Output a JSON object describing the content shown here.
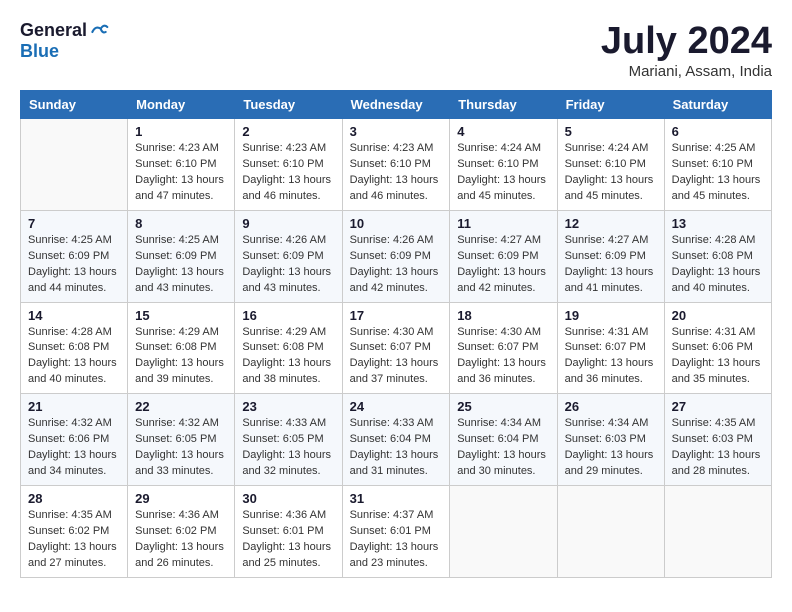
{
  "header": {
    "logo_general": "General",
    "logo_blue": "Blue",
    "month_year": "July 2024",
    "location": "Mariani, Assam, India"
  },
  "calendar": {
    "columns": [
      "Sunday",
      "Monday",
      "Tuesday",
      "Wednesday",
      "Thursday",
      "Friday",
      "Saturday"
    ],
    "weeks": [
      [
        {
          "day": "",
          "info": ""
        },
        {
          "day": "1",
          "info": "Sunrise: 4:23 AM\nSunset: 6:10 PM\nDaylight: 13 hours\nand 47 minutes."
        },
        {
          "day": "2",
          "info": "Sunrise: 4:23 AM\nSunset: 6:10 PM\nDaylight: 13 hours\nand 46 minutes."
        },
        {
          "day": "3",
          "info": "Sunrise: 4:23 AM\nSunset: 6:10 PM\nDaylight: 13 hours\nand 46 minutes."
        },
        {
          "day": "4",
          "info": "Sunrise: 4:24 AM\nSunset: 6:10 PM\nDaylight: 13 hours\nand 45 minutes."
        },
        {
          "day": "5",
          "info": "Sunrise: 4:24 AM\nSunset: 6:10 PM\nDaylight: 13 hours\nand 45 minutes."
        },
        {
          "day": "6",
          "info": "Sunrise: 4:25 AM\nSunset: 6:10 PM\nDaylight: 13 hours\nand 45 minutes."
        }
      ],
      [
        {
          "day": "7",
          "info": "Sunrise: 4:25 AM\nSunset: 6:09 PM\nDaylight: 13 hours\nand 44 minutes."
        },
        {
          "day": "8",
          "info": "Sunrise: 4:25 AM\nSunset: 6:09 PM\nDaylight: 13 hours\nand 43 minutes."
        },
        {
          "day": "9",
          "info": "Sunrise: 4:26 AM\nSunset: 6:09 PM\nDaylight: 13 hours\nand 43 minutes."
        },
        {
          "day": "10",
          "info": "Sunrise: 4:26 AM\nSunset: 6:09 PM\nDaylight: 13 hours\nand 42 minutes."
        },
        {
          "day": "11",
          "info": "Sunrise: 4:27 AM\nSunset: 6:09 PM\nDaylight: 13 hours\nand 42 minutes."
        },
        {
          "day": "12",
          "info": "Sunrise: 4:27 AM\nSunset: 6:09 PM\nDaylight: 13 hours\nand 41 minutes."
        },
        {
          "day": "13",
          "info": "Sunrise: 4:28 AM\nSunset: 6:08 PM\nDaylight: 13 hours\nand 40 minutes."
        }
      ],
      [
        {
          "day": "14",
          "info": "Sunrise: 4:28 AM\nSunset: 6:08 PM\nDaylight: 13 hours\nand 40 minutes."
        },
        {
          "day": "15",
          "info": "Sunrise: 4:29 AM\nSunset: 6:08 PM\nDaylight: 13 hours\nand 39 minutes."
        },
        {
          "day": "16",
          "info": "Sunrise: 4:29 AM\nSunset: 6:08 PM\nDaylight: 13 hours\nand 38 minutes."
        },
        {
          "day": "17",
          "info": "Sunrise: 4:30 AM\nSunset: 6:07 PM\nDaylight: 13 hours\nand 37 minutes."
        },
        {
          "day": "18",
          "info": "Sunrise: 4:30 AM\nSunset: 6:07 PM\nDaylight: 13 hours\nand 36 minutes."
        },
        {
          "day": "19",
          "info": "Sunrise: 4:31 AM\nSunset: 6:07 PM\nDaylight: 13 hours\nand 36 minutes."
        },
        {
          "day": "20",
          "info": "Sunrise: 4:31 AM\nSunset: 6:06 PM\nDaylight: 13 hours\nand 35 minutes."
        }
      ],
      [
        {
          "day": "21",
          "info": "Sunrise: 4:32 AM\nSunset: 6:06 PM\nDaylight: 13 hours\nand 34 minutes."
        },
        {
          "day": "22",
          "info": "Sunrise: 4:32 AM\nSunset: 6:05 PM\nDaylight: 13 hours\nand 33 minutes."
        },
        {
          "day": "23",
          "info": "Sunrise: 4:33 AM\nSunset: 6:05 PM\nDaylight: 13 hours\nand 32 minutes."
        },
        {
          "day": "24",
          "info": "Sunrise: 4:33 AM\nSunset: 6:04 PM\nDaylight: 13 hours\nand 31 minutes."
        },
        {
          "day": "25",
          "info": "Sunrise: 4:34 AM\nSunset: 6:04 PM\nDaylight: 13 hours\nand 30 minutes."
        },
        {
          "day": "26",
          "info": "Sunrise: 4:34 AM\nSunset: 6:03 PM\nDaylight: 13 hours\nand 29 minutes."
        },
        {
          "day": "27",
          "info": "Sunrise: 4:35 AM\nSunset: 6:03 PM\nDaylight: 13 hours\nand 28 minutes."
        }
      ],
      [
        {
          "day": "28",
          "info": "Sunrise: 4:35 AM\nSunset: 6:02 PM\nDaylight: 13 hours\nand 27 minutes."
        },
        {
          "day": "29",
          "info": "Sunrise: 4:36 AM\nSunset: 6:02 PM\nDaylight: 13 hours\nand 26 minutes."
        },
        {
          "day": "30",
          "info": "Sunrise: 4:36 AM\nSunset: 6:01 PM\nDaylight: 13 hours\nand 25 minutes."
        },
        {
          "day": "31",
          "info": "Sunrise: 4:37 AM\nSunset: 6:01 PM\nDaylight: 13 hours\nand 23 minutes."
        },
        {
          "day": "",
          "info": ""
        },
        {
          "day": "",
          "info": ""
        },
        {
          "day": "",
          "info": ""
        }
      ]
    ]
  }
}
